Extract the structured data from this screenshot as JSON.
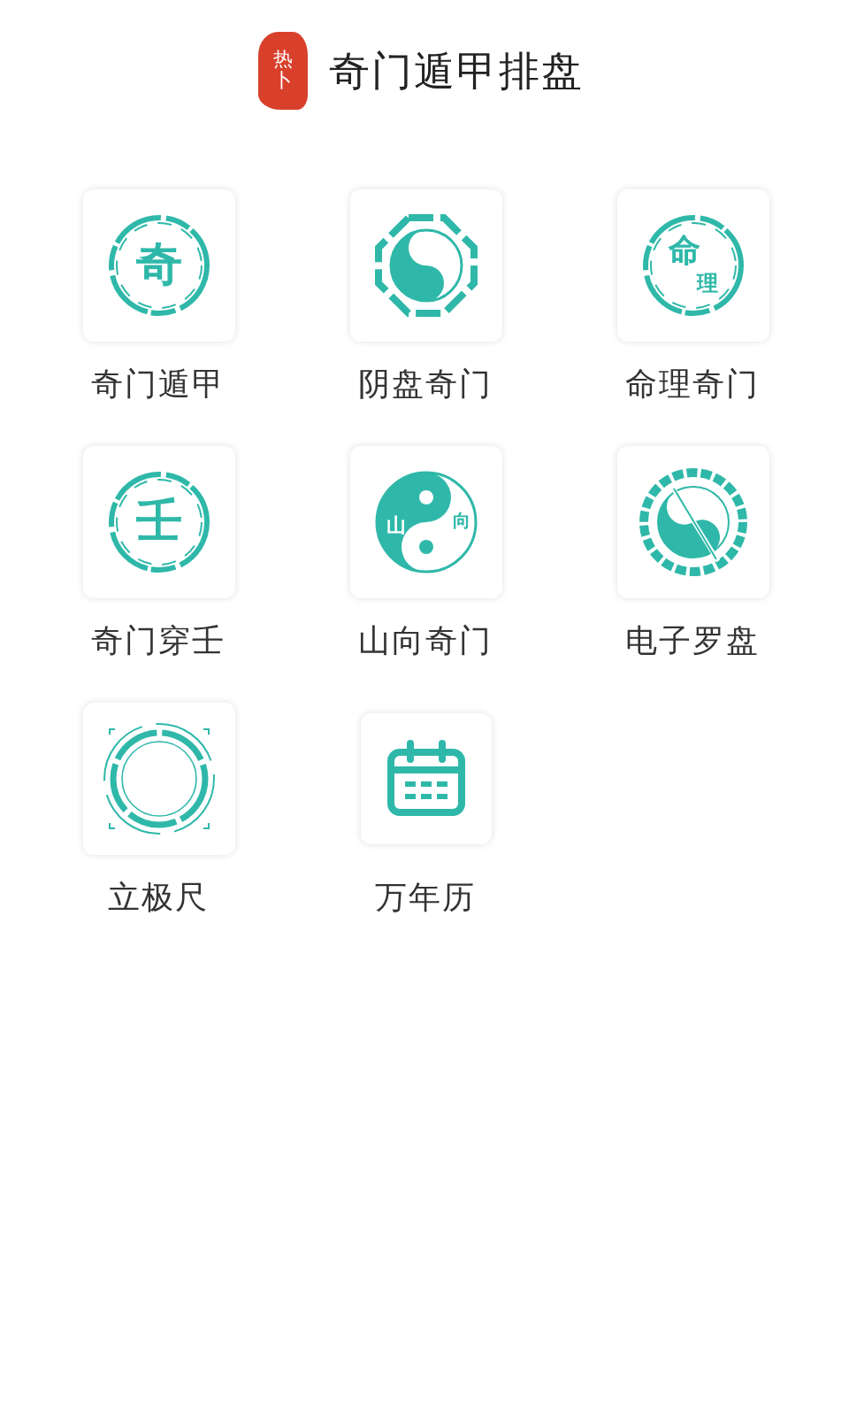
{
  "header": {
    "logo_text": [
      "热",
      "卜"
    ],
    "title": "奇门遁甲排盘"
  },
  "tiles": [
    {
      "label": "奇门遁甲",
      "kind": "ring",
      "glyphs": [
        "奇"
      ]
    },
    {
      "label": "阴盘奇门",
      "kind": "bagua"
    },
    {
      "label": "命理奇门",
      "kind": "ring2",
      "glyphs": [
        "命",
        "理"
      ]
    },
    {
      "label": "奇门穿壬",
      "kind": "ring",
      "glyphs": [
        "壬"
      ]
    },
    {
      "label": "山向奇门",
      "kind": "taiji",
      "glyphs": [
        "山",
        "向"
      ]
    },
    {
      "label": "电子罗盘",
      "kind": "compass"
    },
    {
      "label": "立极尺",
      "kind": "ruler"
    },
    {
      "label": "万年历",
      "kind": "calendar"
    }
  ]
}
